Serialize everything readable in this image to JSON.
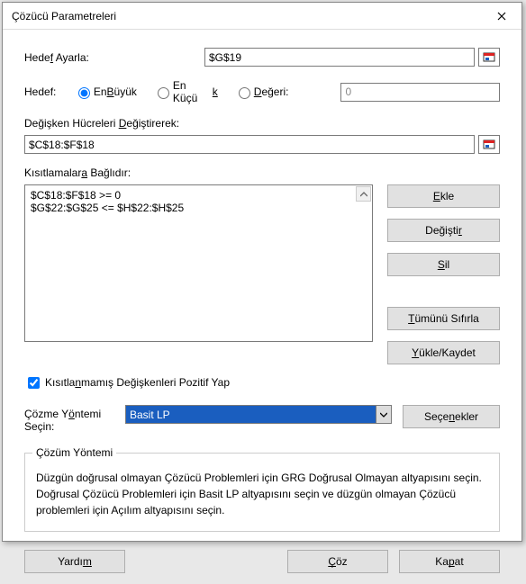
{
  "title": "Çözücü Parametreleri",
  "labels": {
    "set_objective": "Hedef Ayarla:",
    "to": "Hedef:",
    "max": "En Büyük",
    "min": "En Küçük",
    "value_of": "Değeri:",
    "by_changing": "Değişken Hücreleri Değiştirerek:",
    "subject_to": "Kısıtlamalara Bağlıdır:",
    "nonneg": "Kısıtlanmamış Değişkenleri Pozitif Yap",
    "method_label": "Çözme Yöntemi Seçin:"
  },
  "fields": {
    "objective": "$G$19",
    "value_of": "0",
    "changing_cells": "$C$18:$F$18",
    "nonneg_checked": true
  },
  "radios": {
    "selected": "max"
  },
  "constraints": [
    "$C$18:$F$18 >= 0",
    "$G$22:$G$25 <= $H$22:$H$25"
  ],
  "method": {
    "selected": "Basit LP"
  },
  "buttons": {
    "add": "Ekle",
    "change": "Değiştir",
    "delete": "Sil",
    "reset_all": "Tümünü Sıfırla",
    "load_save": "Yükle/Kaydet",
    "options": "Seçenekler",
    "help": "Yardım",
    "solve": "Çöz",
    "close": "Kapat"
  },
  "group": {
    "title": "Çözüm Yöntemi",
    "body": "Düzgün doğrusal olmayan Çözücü Problemleri için GRG Doğrusal Olmayan altyapısını seçin. Doğrusal Çözücü Problemleri için Basit LP altyapısını seçin ve düzgün olmayan Çözücü problemleri için Açılım altyapısını seçin."
  }
}
